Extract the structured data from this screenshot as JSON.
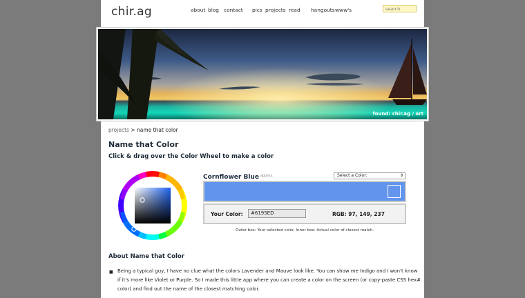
{
  "header": {
    "logo": "chir.ag",
    "nav": [
      "about",
      "blog",
      "contact",
      "pics",
      "projects",
      "read",
      "hangouts",
      "www's"
    ],
    "search_placeholder": "search"
  },
  "banner": {
    "credit": "found: chir.ag / art"
  },
  "breadcrumb": {
    "link": "projects",
    "separator": ">",
    "current": "name that color"
  },
  "content": {
    "title": "Name that Color",
    "instruction": "Click & drag over the Color Wheel to make a color",
    "match_name": "Cornflower Blue",
    "approx": "approx.",
    "select_label": "Select a Color:",
    "your_color_label": "Your Color:",
    "hex_value": "#6195ED",
    "rgb_text": "RGB: 97, 149, 237",
    "caption": "Outer box: Your selected color. Inner box: Actual color of closest match.",
    "about_title": "About Name that Color",
    "about_text": "Being a typical guy, I have no clue what the colors Lavender and Mauve look like. You can show me Indigo and I won't know if it's more like Violet or Purple. So I made this little app where you can create a color on the screen (or copy-paste CSS hex# color) and find out the name of the closest matching color.",
    "bullet_glyph": "■"
  },
  "colors": {
    "selected": "#6195ED",
    "match": "#6495ED",
    "background": "#7b7b7b",
    "search_bg": "#fff8c4"
  },
  "icons": [
    "color-wheel",
    "select-arrow-icon"
  ]
}
